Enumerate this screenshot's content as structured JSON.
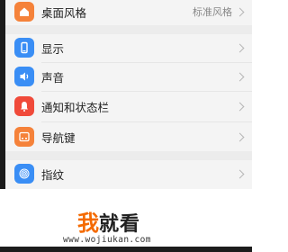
{
  "settings": {
    "items": [
      {
        "label": "桌面风格",
        "value": "标准风格",
        "icon": "home-style-icon",
        "color": "#f5823a"
      },
      {
        "label": "显示",
        "value": "",
        "icon": "display-icon",
        "color": "#3a8ef5"
      },
      {
        "label": "声音",
        "value": "",
        "icon": "speaker-icon",
        "color": "#3a8ef5"
      },
      {
        "label": "通知和状态栏",
        "value": "",
        "icon": "bell-icon",
        "color": "#f04a3a"
      },
      {
        "label": "导航键",
        "value": "",
        "icon": "navigation-key-icon",
        "color": "#f5823a"
      },
      {
        "label": "指纹",
        "value": "",
        "icon": "fingerprint-icon",
        "color": "#3a8ef5"
      }
    ]
  },
  "watermark": {
    "brand_char1": "我",
    "brand_chars_rest": "就看",
    "url": "www.wojiukan.com"
  }
}
